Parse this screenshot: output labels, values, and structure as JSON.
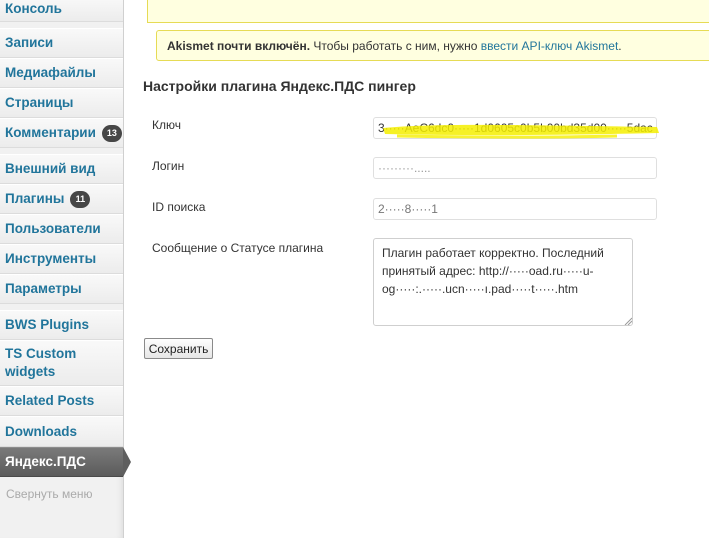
{
  "sidebar": {
    "items": [
      {
        "label": "Консоль"
      },
      {
        "label": "Записи"
      },
      {
        "label": "Медиафайлы"
      },
      {
        "label": "Страницы"
      },
      {
        "label": "Комментарии",
        "badge": "13"
      },
      {
        "label": "Внешний вид"
      },
      {
        "label": "Плагины",
        "badge": "11"
      },
      {
        "label": "Пользователи"
      },
      {
        "label": "Инструменты"
      },
      {
        "label": "Параметры"
      },
      {
        "label": "BWS Plugins"
      },
      {
        "label": "TS Custom widgets"
      },
      {
        "label": "Related Posts"
      },
      {
        "label": "Downloads"
      },
      {
        "label": "Яндекс.ПДС",
        "active": true
      }
    ],
    "collapse_label": "Свернуть меню"
  },
  "notice": {
    "bold": "Akismet почти включён.",
    "text": " Чтобы работать с ним, нужно ",
    "link": "ввести API-ключ Akismet",
    "end": "."
  },
  "page": {
    "title": "Настройки плагина Яндекс.ПДС пингер"
  },
  "form": {
    "key_label": "Ключ",
    "key_value": "3·····AeC6dc0·····1d0605c0b5b00bd35d00·····5dac",
    "login_label": "Логин",
    "login_value": "·········.....",
    "search_id_label": "ID поиска",
    "search_id_value": "2·····8·····1",
    "status_label": "Сообщение о Статусе плагина",
    "status_value": "Плагин работает корректно. Последний принятый адрес: http://·····oad.ru·····u-og·····:.·····.ucn·····ı.pad·····t·····.htm",
    "save_label": "Сохранить"
  },
  "colors": {
    "link": "#21759b",
    "notice_bg": "#ffffe0",
    "notice_border": "#e6db55",
    "highlighter": "#f5ef00"
  }
}
